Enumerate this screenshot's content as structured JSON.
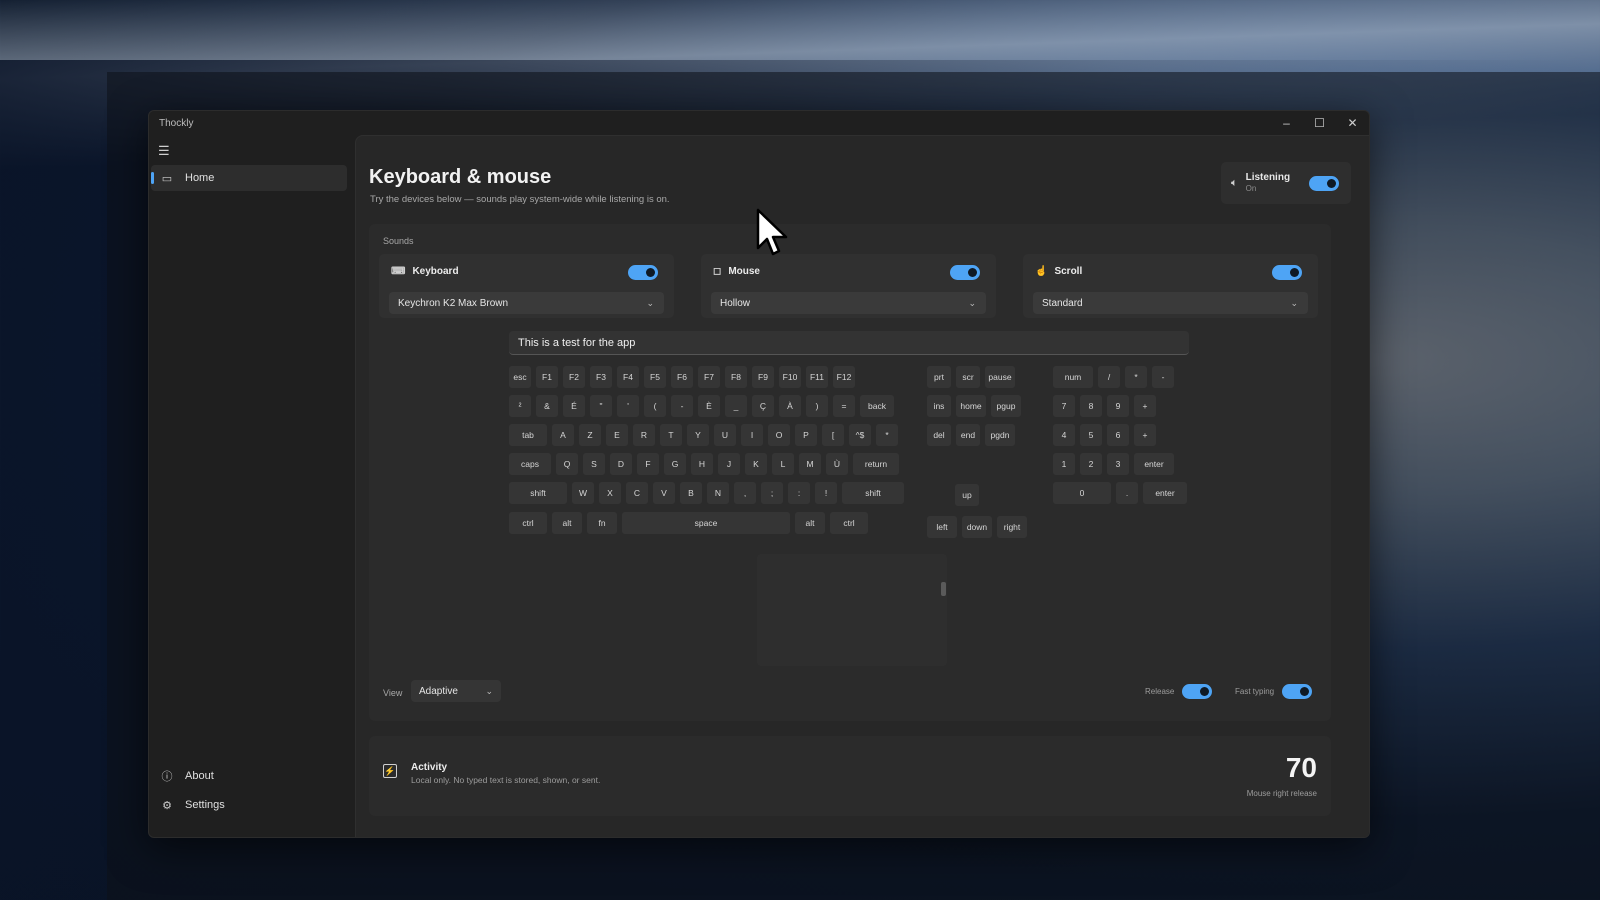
{
  "app": {
    "title": "Thockly"
  },
  "window_controls": {
    "minimize": "–",
    "maximize": "☐",
    "close": "✕"
  },
  "sidebar": {
    "menu_icon": "hamburger-icon",
    "items": [
      {
        "label": "Home",
        "icon": "monitor-icon",
        "active": true
      }
    ],
    "footer": [
      {
        "label": "About",
        "icon": "info-icon"
      },
      {
        "label": "Settings",
        "icon": "gear-icon"
      }
    ]
  },
  "header": {
    "title": "Keyboard & mouse",
    "subtitle": "Try the devices below — sounds play system-wide while listening is on.",
    "listening": {
      "label": "Listening",
      "status": "On",
      "enabled": true
    }
  },
  "sounds": {
    "label": "Sounds",
    "devices": [
      {
        "name": "Keyboard",
        "icon": "keyboard-icon",
        "enabled": true,
        "profile": "Keychron K2 Max Brown"
      },
      {
        "name": "Mouse",
        "icon": "mouse-icon",
        "enabled": true,
        "profile": "Hollow"
      },
      {
        "name": "Scroll",
        "icon": "scroll-icon",
        "enabled": true,
        "profile": "Standard"
      }
    ],
    "test_input": "This is a test for the app",
    "keyboard": {
      "main_rows": [
        [
          "esc",
          "F1",
          "F2",
          "F3",
          "F4",
          "F5",
          "F6",
          "F7",
          "F8",
          "F9",
          "F10",
          "F11",
          "F12"
        ],
        [
          "²",
          "&",
          "É",
          "\"",
          "'",
          "(",
          "-",
          "È",
          "_",
          "Ç",
          "À",
          ")",
          "=",
          "back"
        ],
        [
          "tab",
          "A",
          "Z",
          "E",
          "R",
          "T",
          "Y",
          "U",
          "I",
          "O",
          "P",
          "[",
          "^$",
          "*"
        ],
        [
          "caps",
          "Q",
          "S",
          "D",
          "F",
          "G",
          "H",
          "J",
          "K",
          "L",
          "M",
          "Ù",
          "return"
        ],
        [
          "shift",
          "W",
          "X",
          "C",
          "V",
          "B",
          "N",
          ",",
          ";",
          ":",
          "!",
          "shift"
        ],
        [
          "ctrl",
          "alt",
          "fn",
          "space",
          "alt",
          "ctrl"
        ]
      ],
      "nav_rows": [
        [
          "prt",
          "scr",
          "pause"
        ],
        [
          "ins",
          "home",
          "pgup"
        ],
        [
          "del",
          "end",
          "pgdn"
        ],
        [
          "up"
        ],
        [
          "left",
          "down",
          "right"
        ]
      ],
      "numpad_rows": [
        [
          "num",
          "/",
          "*",
          "-"
        ],
        [
          "7",
          "8",
          "9",
          "+"
        ],
        [
          "4",
          "5",
          "6",
          "+"
        ],
        [
          "1",
          "2",
          "3",
          "enter"
        ],
        [
          "0",
          ".",
          "enter"
        ]
      ]
    },
    "view": {
      "label": "View",
      "value": "Adaptive"
    },
    "options": [
      {
        "label": "Release",
        "enabled": true
      },
      {
        "label": "Fast typing",
        "enabled": true
      }
    ]
  },
  "activity": {
    "title": "Activity",
    "subtitle": "Local only. No typed text is stored, shown, or sent.",
    "count": "70",
    "count_label": "Mouse right release"
  }
}
